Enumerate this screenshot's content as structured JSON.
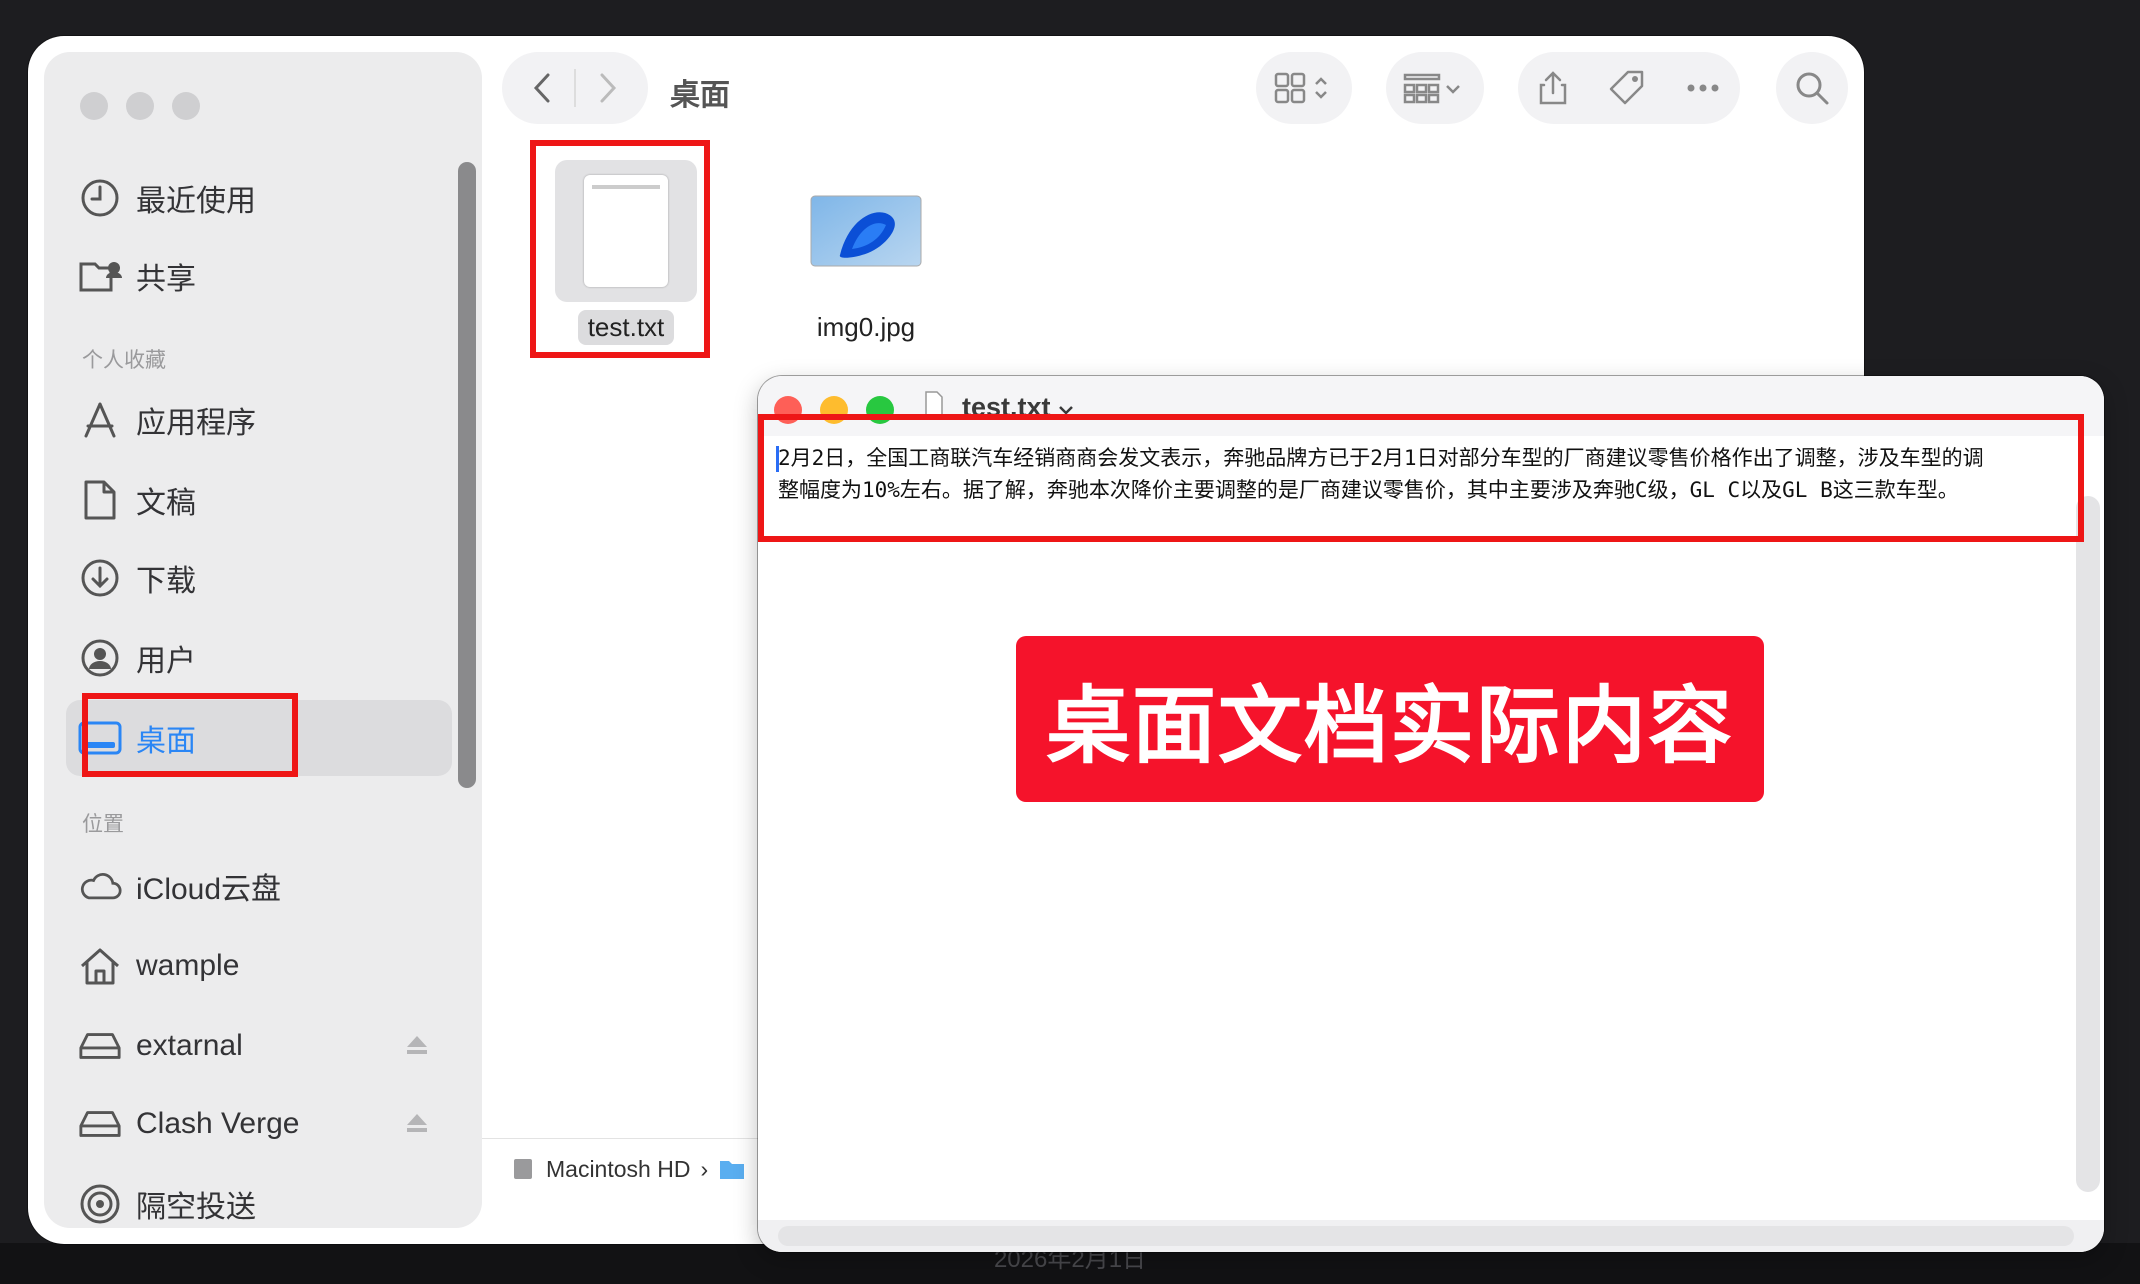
{
  "finder": {
    "title": "桌面",
    "sidebar": {
      "favorites_header": "个人收藏",
      "locations_header": "位置",
      "items": [
        {
          "label": "最近使用",
          "icon": "clock-icon"
        },
        {
          "label": "共享",
          "icon": "shared-folder-icon"
        },
        {
          "label": "应用程序",
          "icon": "applications-icon"
        },
        {
          "label": "文稿",
          "icon": "document-icon"
        },
        {
          "label": "下载",
          "icon": "download-icon"
        },
        {
          "label": "用户",
          "icon": "user-icon"
        },
        {
          "label": "桌面",
          "icon": "desktop-icon",
          "active": true
        },
        {
          "label": "iCloud云盘",
          "icon": "cloud-icon"
        },
        {
          "label": "wample",
          "icon": "home-icon"
        },
        {
          "label": "extarnal",
          "icon": "drive-icon"
        },
        {
          "label": "Clash Verge",
          "icon": "drive-icon"
        },
        {
          "label": "隔空投送",
          "icon": "airdrop-icon"
        }
      ]
    },
    "files": [
      {
        "name": "test.txt",
        "type": "text"
      },
      {
        "name": "img0.jpg",
        "type": "image"
      }
    ],
    "path": {
      "disk": "Macintosh HD",
      "separator": "›"
    }
  },
  "textedit": {
    "title": "test.txt",
    "lines": [
      "2月2日，全国工商联汽车经销商商会发文表示，奔驰品牌方已于2月1日对部分车型的厂商建议零售价格作出了调整，涉及车型的调",
      "整幅度为10%左右。据了解，奔驰本次降价主要调整的是厂商建议零售价，其中主要涉及奔驰C级，GL C以及GL B这三款车型。"
    ]
  },
  "annotation": {
    "banner": "桌面文档实际内容"
  },
  "taskbar": {
    "date": "2026年2月1日"
  },
  "colors": {
    "highlight": "#ee1616",
    "banner": "#f5132b",
    "accent": "#2a86f5"
  }
}
